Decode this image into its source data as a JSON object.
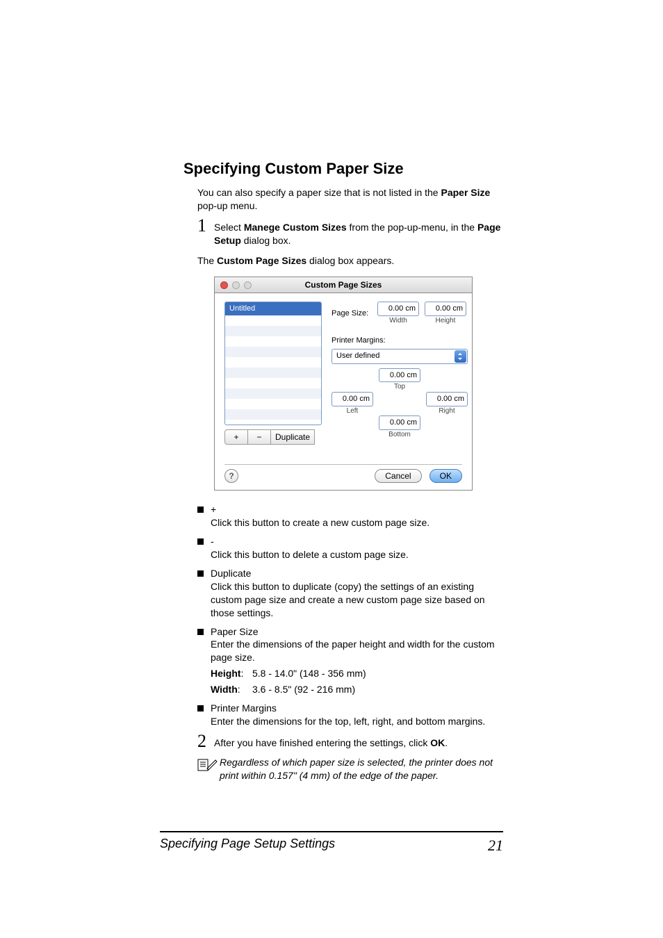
{
  "heading": "Specifying Custom Paper Size",
  "intro_a": "You can also specify a paper size that is not listed in the ",
  "intro_b": "Paper Size",
  "intro_c": " pop-up menu.",
  "step1": {
    "num": "1",
    "a": "Select ",
    "b": "Manege Custom Sizes",
    "c": " from the pop-up-menu, in the ",
    "d": "Page Setup",
    "e": " dialog box."
  },
  "after_step1_a": "The ",
  "after_step1_b": "Custom Page Sizes",
  "after_step1_c": " dialog box appears.",
  "dialog": {
    "title": "Custom Page Sizes",
    "list_selected": "Untitled",
    "btn_plus": "+",
    "btn_minus": "−",
    "btn_dup": "Duplicate",
    "pagesize_label": "Page Size:",
    "width_val": "0.00 cm",
    "width_lbl": "Width",
    "height_val": "0.00 cm",
    "height_lbl": "Height",
    "margins_heading": "Printer Margins:",
    "select_value": "User defined",
    "m_top": "0.00 cm",
    "m_top_lbl": "Top",
    "m_left": "0.00 cm",
    "m_left_lbl": "Left",
    "m_right": "0.00 cm",
    "m_right_lbl": "Right",
    "m_bottom": "0.00 cm",
    "m_bottom_lbl": "Bottom",
    "help": "?",
    "cancel": "Cancel",
    "ok": "OK"
  },
  "bullets": {
    "plus_h": "+",
    "plus_t": "Click this button to create a new custom page size.",
    "minus_h": "-",
    "minus_t": "Click this button to delete a custom page size.",
    "dup_h": "Duplicate",
    "dup_t": "Click this button to duplicate (copy) the settings of an existing custom page size and create a new custom page size based on those settings.",
    "ps_h": "Paper Size",
    "ps_t": "Enter the dimensions of the paper height and width for the custom page size.",
    "height_k": "Height",
    "height_v": "5.8 - 14.0\" (148 - 356 mm)",
    "width_k": "Width",
    "width_v": "3.6 - 8.5\" (92 - 216 mm)",
    "pm_h": "Printer Margins",
    "pm_t": "Enter the dimensions for the top, left, right, and bottom margins."
  },
  "step2": {
    "num": "2",
    "a": "After you have finished entering the settings, click ",
    "b": "OK",
    "c": "."
  },
  "note": "Regardless of which paper size is selected, the printer does not print within 0.157\" (4 mm) of the edge of the paper.",
  "footer_text": "Specifying Page Setup Settings",
  "page_number": "21"
}
